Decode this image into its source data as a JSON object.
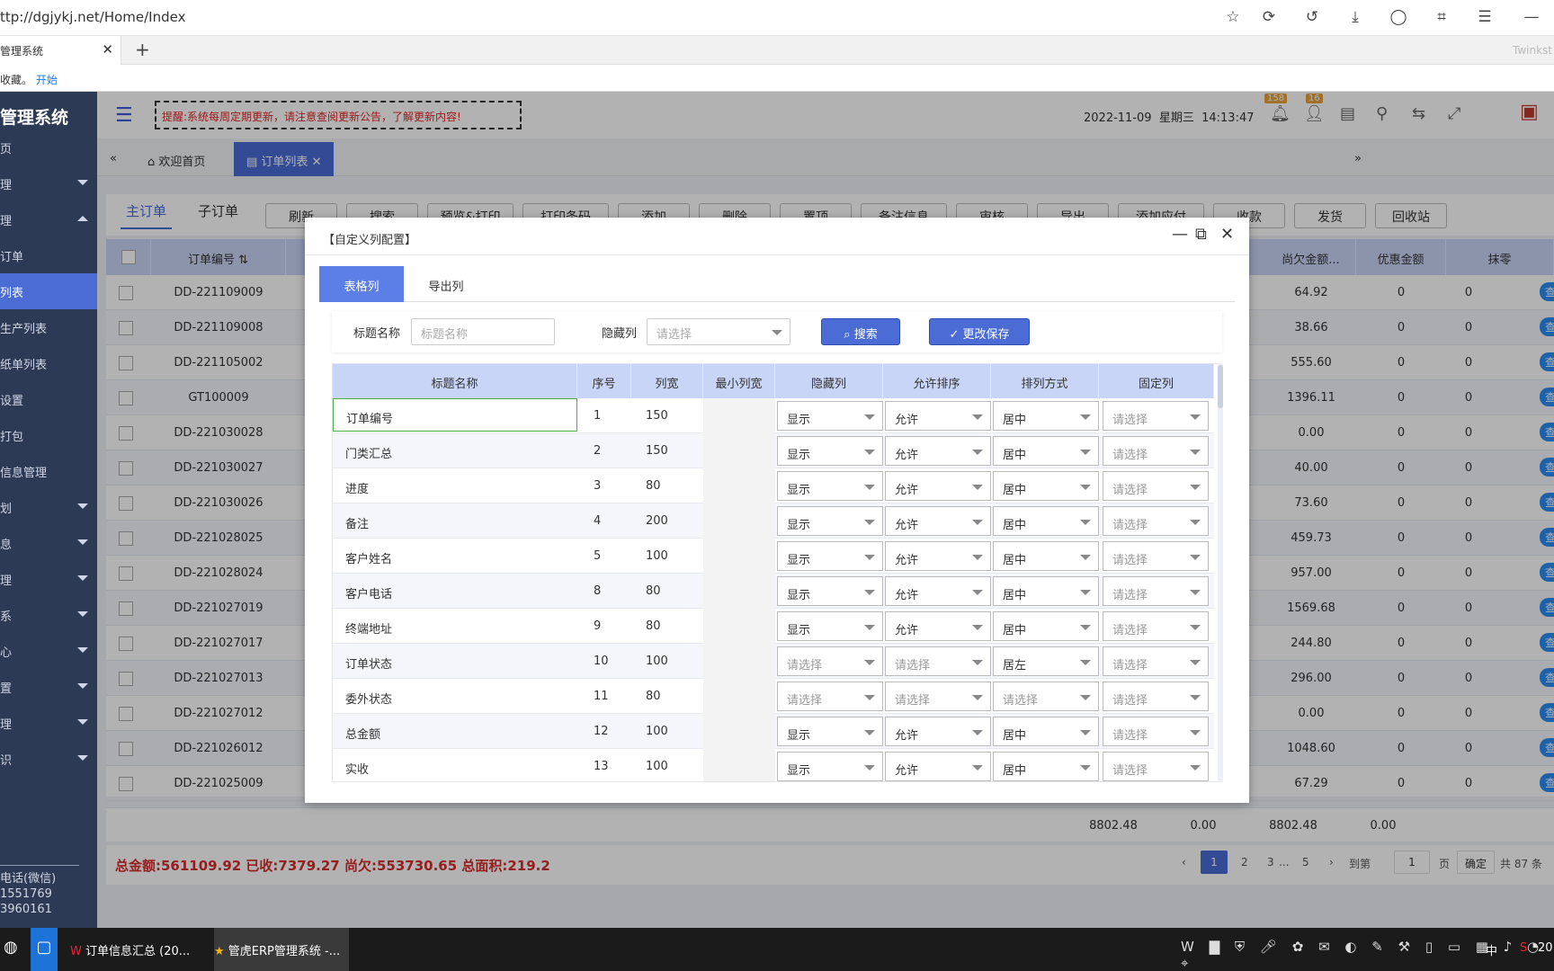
{
  "browser": {
    "url": "ttp://dgjykj.net/Home/Index",
    "tab_title": "管理系统",
    "fav_text": "收藏。",
    "fav_link": "开始",
    "side_label": "Twinkst"
  },
  "sidebar": {
    "brand": "管理系统",
    "items": [
      {
        "label": "页",
        "caret": "none"
      },
      {
        "label": "理",
        "caret": "down"
      },
      {
        "label": "理",
        "caret": "up"
      },
      {
        "label": "订单",
        "caret": "none"
      },
      {
        "label": "列表",
        "caret": "none",
        "active": true
      },
      {
        "label": "生产列表",
        "caret": "none"
      },
      {
        "label": "纸单列表",
        "caret": "none"
      },
      {
        "label": "设置",
        "caret": "none"
      },
      {
        "label": "打包",
        "caret": "none"
      },
      {
        "label": "信息管理",
        "caret": "none"
      },
      {
        "label": "划",
        "caret": "down"
      },
      {
        "label": "息",
        "caret": "down"
      },
      {
        "label": "理",
        "caret": "down"
      },
      {
        "label": "系",
        "caret": "down"
      },
      {
        "label": "心",
        "caret": "down"
      },
      {
        "label": "置",
        "caret": "down"
      },
      {
        "label": "理",
        "caret": "down"
      },
      {
        "label": "识",
        "caret": "down"
      }
    ],
    "contact": [
      "电话(微信)",
      "1551769",
      "3960161"
    ]
  },
  "topbar": {
    "notice": "提醒:系统每周定期更新，请注意查阅更新公告，了解更新内容!",
    "date": "2022-11-09",
    "weekday": "星期三",
    "time": "14:13:47",
    "badge_notify": "158",
    "badge_user": "16"
  },
  "pagetabs": {
    "home": "欢迎首页",
    "orders": "订单列表"
  },
  "main": {
    "subtabs": [
      "主订单",
      "子订单"
    ],
    "toolbar": [
      "刷新",
      "搜索",
      "预览&打印",
      "打印条码",
      "添加",
      "删除",
      "置顶",
      "备注信息",
      "审核",
      "导出",
      "添加应付",
      "收款",
      "发货",
      "回收站"
    ],
    "headers": {
      "order_no": "订单编号",
      "owed": "尚欠金额...",
      "discount": "优惠金额",
      "rounding": "抹零"
    },
    "rows": [
      {
        "no": "DD-221109009",
        "owed": "64.92",
        "discount": "0",
        "rounding": "0"
      },
      {
        "no": "DD-221109008",
        "owed": "38.66",
        "discount": "0",
        "rounding": "0"
      },
      {
        "no": "DD-221105002",
        "owed": "555.60",
        "discount": "0",
        "rounding": "0"
      },
      {
        "no": "GT100009",
        "owed": "1396.11",
        "discount": "0",
        "rounding": "0"
      },
      {
        "no": "DD-221030028",
        "owed": "0.00",
        "discount": "0",
        "rounding": "0"
      },
      {
        "no": "DD-221030027",
        "owed": "40.00",
        "discount": "0",
        "rounding": "0"
      },
      {
        "no": "DD-221030026",
        "owed": "73.60",
        "discount": "0",
        "rounding": "0"
      },
      {
        "no": "DD-221028025",
        "owed": "459.73",
        "discount": "0",
        "rounding": "0"
      },
      {
        "no": "DD-221028024",
        "owed": "957.00",
        "discount": "0",
        "rounding": "0"
      },
      {
        "no": "DD-221027019",
        "owed": "1569.68",
        "discount": "0",
        "rounding": "0"
      },
      {
        "no": "DD-221027017",
        "owed": "244.80",
        "discount": "0",
        "rounding": "0"
      },
      {
        "no": "DD-221027013",
        "owed": "296.00",
        "discount": "0",
        "rounding": "0"
      },
      {
        "no": "DD-221027012",
        "owed": "0.00",
        "discount": "0",
        "rounding": "0"
      },
      {
        "no": "DD-221026012",
        "owed": "1048.60",
        "discount": "0",
        "rounding": "0"
      },
      {
        "no": "DD-221025009",
        "owed": "67.29",
        "discount": "0",
        "rounding": "0"
      }
    ],
    "view_label": "查看",
    "summary": {
      "a": "8802.48",
      "b": "0.00",
      "c": "8802.48",
      "d": "0.00"
    },
    "totals": "总金额:561109.92   已收:7379.27   尚欠:553730.65   总面积:219.2",
    "pagination": {
      "pages": [
        "1",
        "2",
        "3",
        "...",
        "5"
      ],
      "goto": "到第",
      "goto_value": "1",
      "page": "页",
      "confirm": "确定",
      "total": "共 87 条"
    }
  },
  "modal": {
    "title": "【自定义列配置】",
    "tabs": [
      "表格列",
      "导出列"
    ],
    "filter": {
      "title_label": "标题名称",
      "title_placeholder": "标题名称",
      "hidden_label": "隐藏列",
      "hidden_placeholder": "请选择",
      "search": "搜索",
      "save": "更改保存"
    },
    "headers": [
      "标题名称",
      "序号",
      "列宽",
      "最小列宽",
      "隐藏列",
      "允许排序",
      "排列方式",
      "固定列"
    ],
    "rows": [
      {
        "name": "订单编号",
        "seq": "1",
        "width": "150",
        "minw": "",
        "hidden": "显示",
        "sort": "允许",
        "align": "居中",
        "fixed": "请选择"
      },
      {
        "name": "门类汇总",
        "seq": "2",
        "width": "150",
        "minw": "",
        "hidden": "显示",
        "sort": "允许",
        "align": "居中",
        "fixed": "请选择"
      },
      {
        "name": "进度",
        "seq": "3",
        "width": "80",
        "minw": "",
        "hidden": "显示",
        "sort": "允许",
        "align": "居中",
        "fixed": "请选择"
      },
      {
        "name": "备注",
        "seq": "4",
        "width": "200",
        "minw": "",
        "hidden": "显示",
        "sort": "允许",
        "align": "居中",
        "fixed": "请选择"
      },
      {
        "name": "客户姓名",
        "seq": "5",
        "width": "100",
        "minw": "",
        "hidden": "显示",
        "sort": "允许",
        "align": "居中",
        "fixed": "请选择"
      },
      {
        "name": "客户电话",
        "seq": "8",
        "width": "80",
        "minw": "",
        "hidden": "显示",
        "sort": "允许",
        "align": "居中",
        "fixed": "请选择"
      },
      {
        "name": "终端地址",
        "seq": "9",
        "width": "80",
        "minw": "",
        "hidden": "显示",
        "sort": "允许",
        "align": "居中",
        "fixed": "请选择"
      },
      {
        "name": "订单状态",
        "seq": "10",
        "width": "100",
        "minw": "",
        "hidden": "请选择",
        "sort": "请选择",
        "align": "居左",
        "fixed": "请选择"
      },
      {
        "name": "委外状态",
        "seq": "11",
        "width": "80",
        "minw": "",
        "hidden": "请选择",
        "sort": "请选择",
        "align": "请选择",
        "fixed": "请选择"
      },
      {
        "name": "总金额",
        "seq": "12",
        "width": "100",
        "minw": "",
        "hidden": "显示",
        "sort": "允许",
        "align": "居中",
        "fixed": "请选择"
      },
      {
        "name": "实收",
        "seq": "13",
        "width": "100",
        "minw": "",
        "hidden": "显示",
        "sort": "允许",
        "align": "居中",
        "fixed": "请选择"
      }
    ]
  },
  "taskbar": {
    "items": [
      "订单信息汇总 (20...",
      "管虎ERP管理系统 -..."
    ],
    "ime": "中",
    "clock": "20"
  },
  "colors": {
    "accent": "#4a6cd4",
    "sidebar": "#2d3a55",
    "header": "#c9d5f7",
    "alert": "#e02424"
  }
}
